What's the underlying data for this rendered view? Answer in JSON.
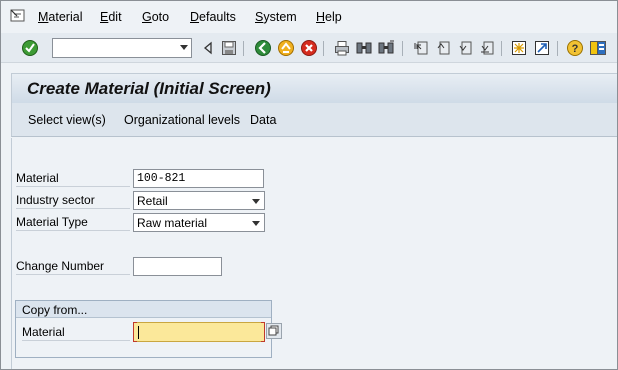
{
  "menubar": {
    "items": [
      {
        "label": "Material",
        "mnemonic": "M",
        "rest": "aterial"
      },
      {
        "label": "Edit",
        "mnemonic": "E",
        "rest": "dit"
      },
      {
        "label": "Goto",
        "mnemonic": "G",
        "rest": "oto"
      },
      {
        "label": "Defaults",
        "mnemonic": "D",
        "rest": "efaults"
      },
      {
        "label": "System",
        "mnemonic": "S",
        "rest": "ystem"
      },
      {
        "label": "Help",
        "mnemonic": "H",
        "rest": "elp"
      }
    ]
  },
  "toolbar": {
    "command_field_value": "",
    "icons": [
      "enter-check-icon",
      "command-field",
      "collapse-icon",
      "save-icon",
      "back-icon",
      "exit-icon",
      "cancel-icon",
      "print-icon",
      "find-icon",
      "find-next-icon",
      "first-page-icon",
      "previous-page-icon",
      "next-page-icon",
      "last-page-icon",
      "create-session-icon",
      "shortcut-icon",
      "help-icon",
      "layout-menu-icon"
    ]
  },
  "screen": {
    "title": "Create Material (Initial Screen)",
    "app_buttons": [
      "Select view(s)",
      "Organizational levels",
      "Data"
    ]
  },
  "form": {
    "material_label": "Material",
    "material_value": "100-821",
    "industry_label": "Industry sector",
    "industry_value": "Retail",
    "type_label": "Material Type",
    "type_value": "Raw material",
    "change_label": "Change Number",
    "change_value": ""
  },
  "copy_from": {
    "header": "Copy from...",
    "material_label": "Material",
    "material_value": ""
  },
  "colors": {
    "required_field": "#fbe89a",
    "background": "#eef2f6",
    "title_gradient_bottom": "#cfdbe7"
  }
}
